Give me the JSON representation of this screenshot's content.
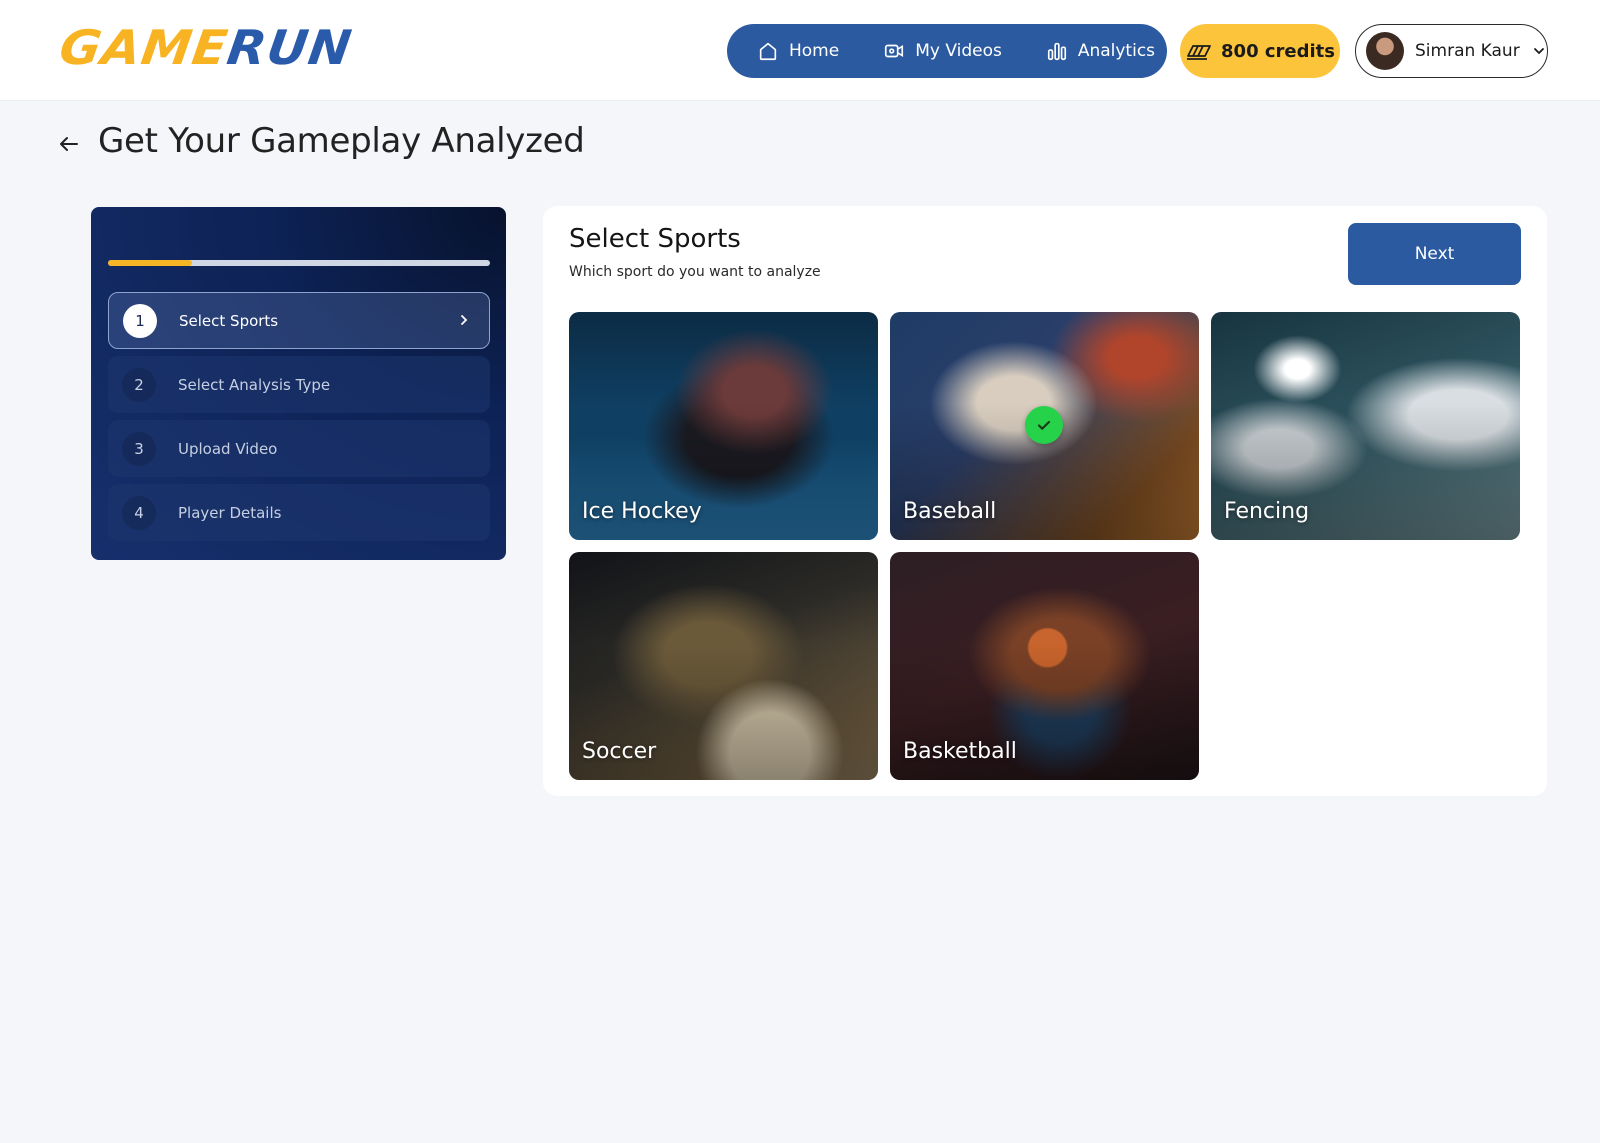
{
  "brand": {
    "logo_part1": "GAME",
    "logo_part2": "RUN"
  },
  "nav": {
    "items": [
      {
        "label": "Home",
        "icon": "home-icon"
      },
      {
        "label": "My Videos",
        "icon": "video-icon"
      },
      {
        "label": "Analytics",
        "icon": "bar-chart-icon"
      }
    ]
  },
  "credits": {
    "label": "800 credits",
    "icon": "credits-icon"
  },
  "user": {
    "name": "Simran Kaur"
  },
  "page": {
    "title": "Get Your Gameplay Analyzed"
  },
  "stepper": {
    "progress": 0.22,
    "steps": [
      {
        "num": "1",
        "label": "Select Sports",
        "active": true
      },
      {
        "num": "2",
        "label": "Select Analysis Type",
        "active": false
      },
      {
        "num": "3",
        "label": "Upload Video",
        "active": false
      },
      {
        "num": "4",
        "label": "Player Details",
        "active": false
      }
    ]
  },
  "card": {
    "title": "Select Sports",
    "subtitle": "Which sport do you want to analyze",
    "next_label": "Next",
    "sports": [
      {
        "label": "Ice Hockey",
        "selected": false
      },
      {
        "label": "Baseball",
        "selected": true
      },
      {
        "label": "Fencing",
        "selected": false
      },
      {
        "label": "Soccer",
        "selected": false
      },
      {
        "label": "Basketball",
        "selected": false
      }
    ]
  },
  "colors": {
    "primary": "#2c5aa0",
    "accent": "#fbc43a",
    "logo_yellow": "#f7b321",
    "selected_check": "#27d24b"
  }
}
